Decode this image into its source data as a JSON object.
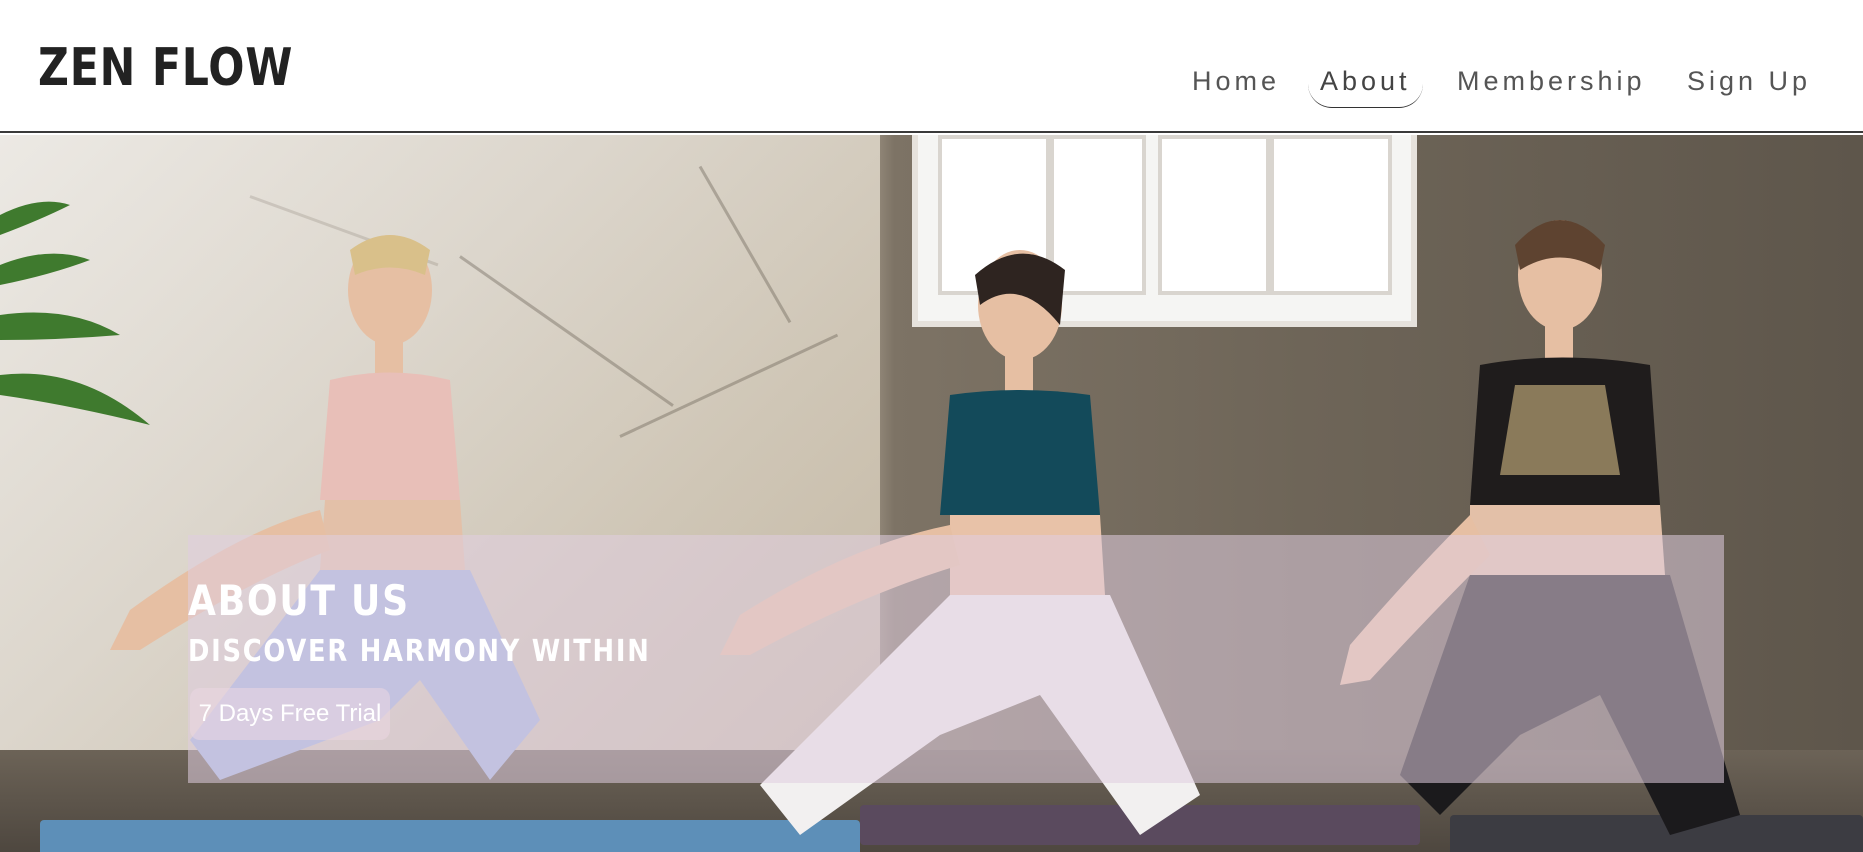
{
  "brand": {
    "logo_text": "ZEN FLOW"
  },
  "nav": {
    "items": [
      {
        "label": "Home",
        "active": false
      },
      {
        "label": "About",
        "active": true
      },
      {
        "label": "Membership",
        "active": false
      },
      {
        "label": "Sign Up",
        "active": false
      }
    ]
  },
  "hero": {
    "title": "ABOUT US",
    "subtitle": "DISCOVER HARMONY WITHIN",
    "cta_label": "7 Days Free Trial",
    "image_subject": "three-women-yoga-lunge-pose"
  },
  "colors": {
    "header_bg": "#ffffff",
    "logo": "#222222",
    "nav_text": "#555555",
    "overlay": "#e0cee0",
    "hero_text": "#ffffff"
  }
}
